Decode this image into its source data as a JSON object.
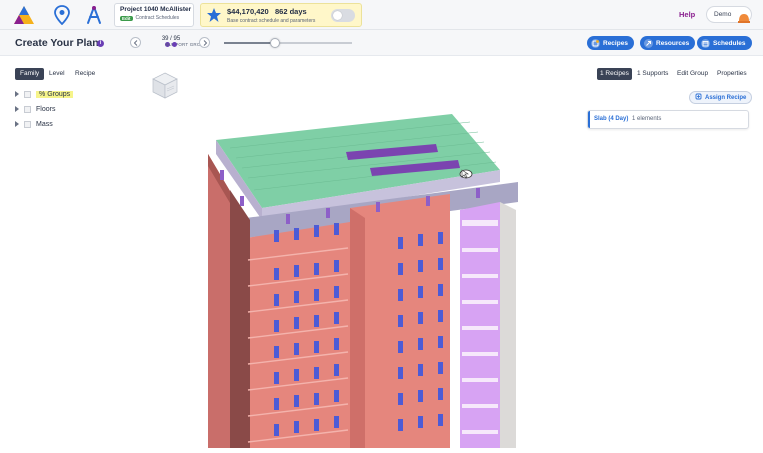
{
  "topbar": {
    "icons": [
      "logo-icon",
      "location-pin-icon",
      "tool-icon"
    ],
    "project_name": "Project 1040 McAllister",
    "project_badge": "Edit",
    "project_subtitle": "Contract Schedules",
    "budget_amount": "$44,170,420",
    "budget_days": "862 days",
    "budget_description": "Base contract schedule and parameters",
    "help_label": "Help",
    "user_name": "Demo",
    "colors": {
      "accent": "#2a6fd6",
      "help": "#8a1f8f",
      "budget_bg": "#fff7c9"
    }
  },
  "plan": {
    "title": "Create Your Plan",
    "info_glyph": "i",
    "counter_value": "39 / 95",
    "counter_label": "SUPPORT GROUP",
    "slider_value": 0.4,
    "buttons": [
      {
        "label": "Recipes",
        "icon": "recipes-icon"
      },
      {
        "label": "Resources",
        "icon": "resources-icon"
      },
      {
        "label": "Schedules",
        "icon": "schedules-icon"
      }
    ]
  },
  "left": {
    "tabs": [
      "Family",
      "Level",
      "Recipe"
    ],
    "active_tab": "Family",
    "tree": [
      "Groups",
      "Floors",
      "Mass"
    ]
  },
  "right": {
    "tabs": [
      "1 Recipes",
      "1 Supports",
      "Edit Group",
      "Properties"
    ],
    "active_tab": "1 Recipes",
    "assign_label": "Assign Recipe",
    "recipe_name": "Slab (4 Day)",
    "recipe_count": "1 elements"
  }
}
